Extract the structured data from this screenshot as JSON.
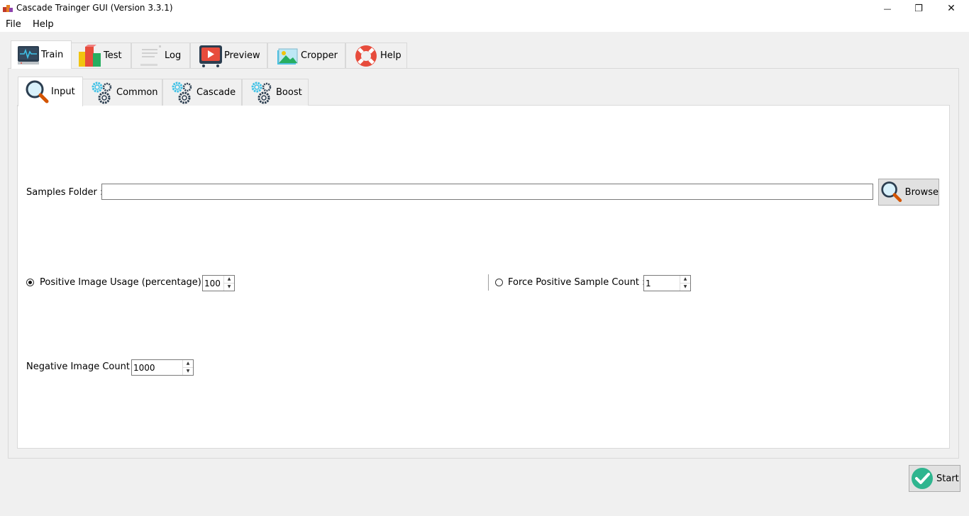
{
  "window": {
    "title": "Cascade Trainger GUI (Version 3.3.1)",
    "minimize_glyph": "—",
    "restore_glyph": "❐",
    "close_glyph": "✕"
  },
  "menu": {
    "items": [
      "File",
      "Help"
    ]
  },
  "main_tabs": [
    {
      "label": "Train",
      "icon": "monitor-pulse-icon",
      "active": true
    },
    {
      "label": "Test",
      "icon": "blocks-icon",
      "active": false
    },
    {
      "label": "Log",
      "icon": "document-lines-icon",
      "active": false
    },
    {
      "label": "Preview",
      "icon": "play-screen-icon",
      "active": false
    },
    {
      "label": "Cropper",
      "icon": "picture-icon",
      "active": false
    },
    {
      "label": "Help",
      "icon": "lifebuoy-icon",
      "active": false
    }
  ],
  "sub_tabs": [
    {
      "label": "Input",
      "icon": "magnifier-icon",
      "active": true
    },
    {
      "label": "Common",
      "icon": "gears-icon",
      "active": false
    },
    {
      "label": "Cascade",
      "icon": "gears-icon",
      "active": false
    },
    {
      "label": "Boost",
      "icon": "gears-icon",
      "active": false
    }
  ],
  "form": {
    "samples_folder_label": "Samples Folder :",
    "samples_folder_value": "",
    "browse_label": "Browse",
    "positive_usage_label": "Positive Image Usage (percentage) :",
    "positive_usage_value": "100",
    "positive_usage_selected": true,
    "force_positive_label": "Force Positive Sample Count :",
    "force_positive_value": "1",
    "force_positive_selected": false,
    "negative_count_label": "Negative Image Count :",
    "negative_count_value": "1000"
  },
  "start_label": "Start",
  "colors": {
    "accent_blue": "#2196c9",
    "start_green": "#2fb58f",
    "help_red": "#e74c3c"
  }
}
